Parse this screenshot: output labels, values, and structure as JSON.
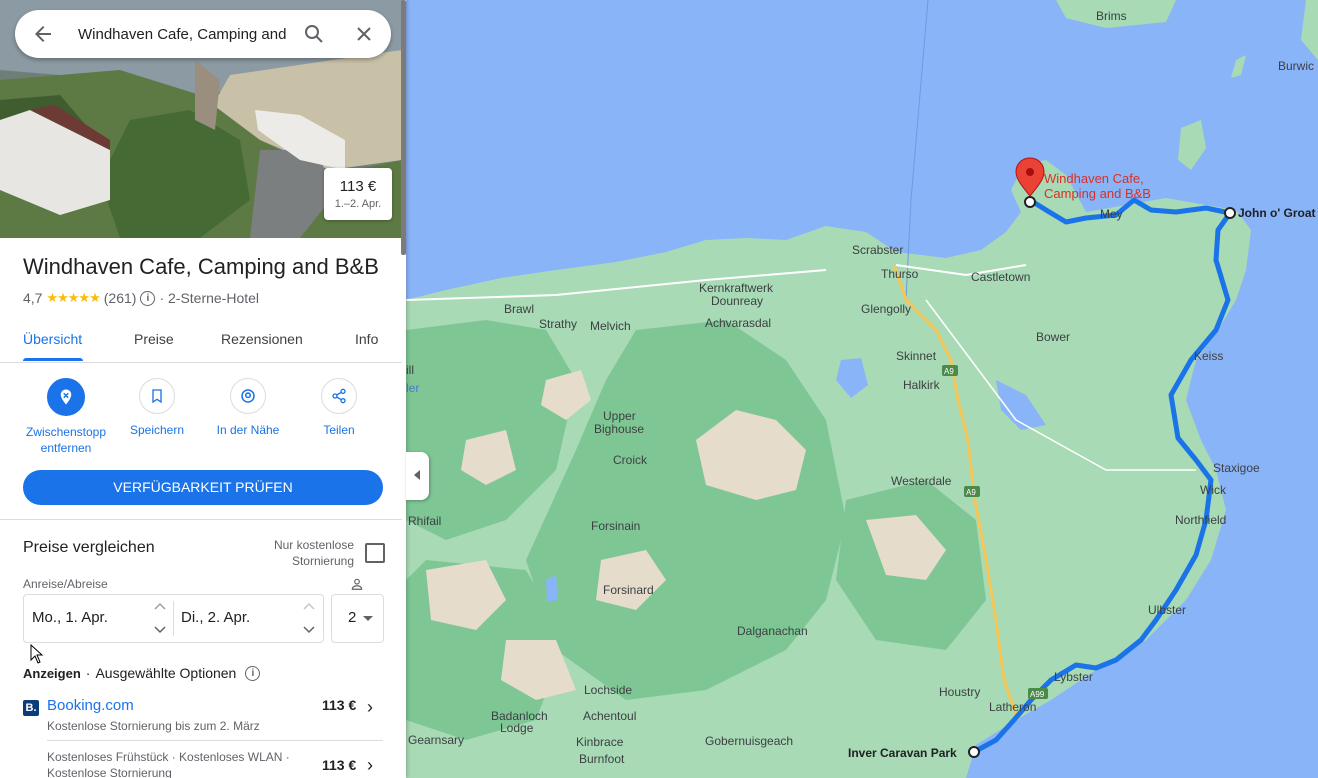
{
  "search": {
    "value": "Windhaven Cafe, Camping and B&B"
  },
  "hero": {
    "price": "113 €",
    "dates": "1.–2. Apr."
  },
  "place": {
    "title": "Windhaven Cafe, Camping and B&B",
    "rating": "4,7",
    "stars": "★★★★★",
    "review_count": "(261)",
    "category": "· 2-Sterne-Hotel"
  },
  "tabs": [
    {
      "label": "Übersicht"
    },
    {
      "label": "Preise"
    },
    {
      "label": "Rezensionen"
    },
    {
      "label": "Info"
    }
  ],
  "actions": [
    {
      "label": "Zwischenstopp entfernen",
      "icon": "remove-stop-icon"
    },
    {
      "label": "Speichern",
      "icon": "bookmark-icon"
    },
    {
      "label": "In der Nähe",
      "icon": "nearby-icon"
    },
    {
      "label": "Teilen",
      "icon": "share-icon"
    }
  ],
  "availability_button": "VERFÜGBARKEIT PRÜFEN",
  "compare": {
    "title": "Preise vergleichen",
    "free_cancel_label": "Nur kostenlose Stornierung",
    "dates_label": "Anreise/Abreise",
    "checkin": "Mo., 1. Apr.",
    "checkout": "Di., 2. Apr.",
    "guests": "2"
  },
  "ads": {
    "label": "Anzeigen",
    "dot": "·",
    "options": "Ausgewählte Optionen"
  },
  "providers": [
    {
      "logo": "B.",
      "name": "Booking.com",
      "sub": "Kostenlose Stornierung bis zum 2. März",
      "price": "113 €"
    },
    {
      "name": "",
      "sub": "Kostenloses Frühstück · Kostenloses WLAN · Kostenlose Stornierung",
      "price": "113 €"
    }
  ],
  "map": {
    "colors": {
      "sea": "#8ab4f8",
      "land": "#a8dab5",
      "forest": "#7fc695",
      "heath": "#e6dccb",
      "route": "#1a73e8",
      "pin": "#ea4335"
    },
    "labels": {
      "brims": "Brims",
      "burwick": "Burwic",
      "dest": "Windhaven Cafe,",
      "dest2": "Camping and B&B",
      "mey": "Mey",
      "johnogroats": "John o' Groat",
      "scrabster": "Scrabster",
      "thurso": "Thurso",
      "castletown": "Castletown",
      "kernkraftwerk": "Kernkraftwerk",
      "dounreay": "Dounreay",
      "brawl": "Brawl",
      "strathy": "Strathy",
      "melvich": "Melvich",
      "achvarasdal": "Achvarasdal",
      "glengolly": "Glengolly",
      "bower": "Bower",
      "keiss": "Keiss",
      "skinnet": "Skinnet",
      "halkirk": "Halkirk",
      "upper": "Upper",
      "bighouse": "Bighouse",
      "croick": "Croick",
      "westerdale": "Westerdale",
      "staxigoe": "Staxigoe",
      "wick": "Wick",
      "northfield": "Northfield",
      "rhifail": "Rhifail",
      "forsinain": "Forsinain",
      "forsinard": "Forsinard",
      "ulbster": "Ulbster",
      "dalganachan": "Dalganachan",
      "lybster": "Lybster",
      "lochside": "Lochside",
      "houstry": "Houstry",
      "latheron": "Latheron",
      "badanloch": "Badanloch",
      "lodge": "Lodge",
      "achentoul": "Achentoul",
      "gearnsary": "Gearnsary",
      "kinbrace": "Kinbrace",
      "burnfoot": "Burnfoot",
      "gobernuisgeach": "Gobernuisgeach",
      "inver": "Inver Caravan Park",
      "a9a": "A9",
      "a9b": "A9",
      "a99": "A99",
      "edge1": "ill",
      "edge2": "ler"
    }
  }
}
